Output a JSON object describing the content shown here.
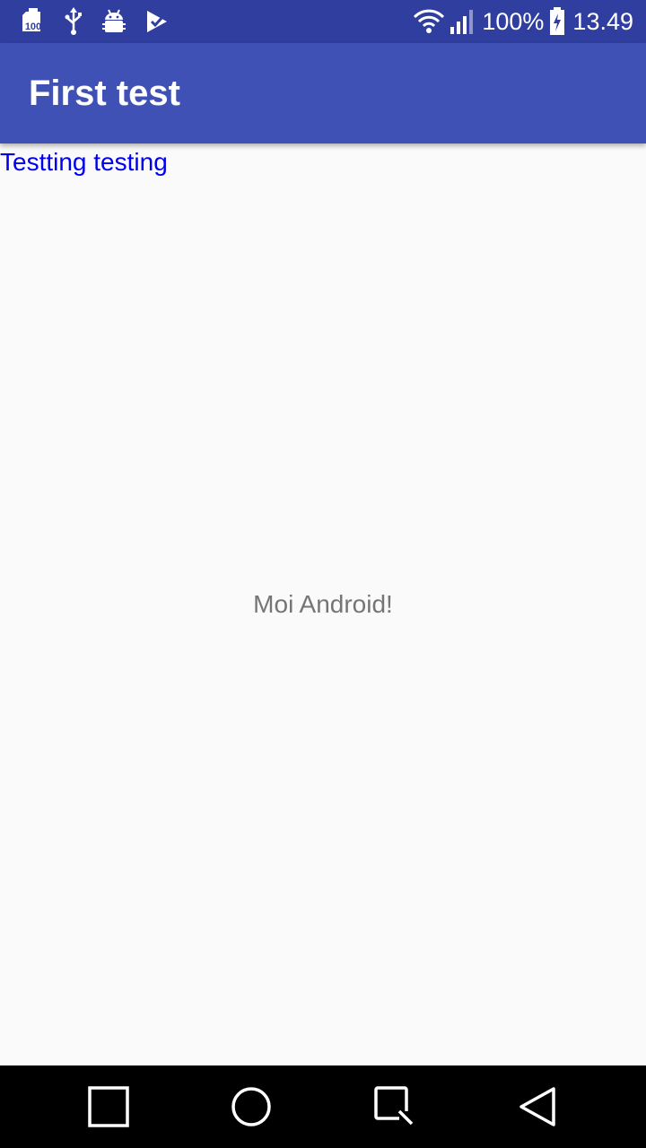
{
  "status_bar": {
    "left_icons": [
      "memory-100-icon",
      "usb-icon",
      "android-debug-icon",
      "play-store-icon"
    ],
    "right_icons": [
      "wifi-icon",
      "signal-icon",
      "battery-charging-icon"
    ],
    "battery_percent": "100%",
    "time": "13.49"
  },
  "app_bar": {
    "title": "First test"
  },
  "content": {
    "link_text": "Testting testing",
    "center_text": "Moi Android!"
  },
  "nav_bar": {
    "buttons": [
      "square-icon",
      "circle-icon",
      "recent-apps-icon",
      "back-triangle-icon"
    ]
  },
  "colors": {
    "status_bar": "#303f9f",
    "app_bar": "#3f51b5",
    "background": "#fafafa",
    "link": "#0000ee",
    "center_text": "#757575",
    "nav_bar": "#000000"
  }
}
